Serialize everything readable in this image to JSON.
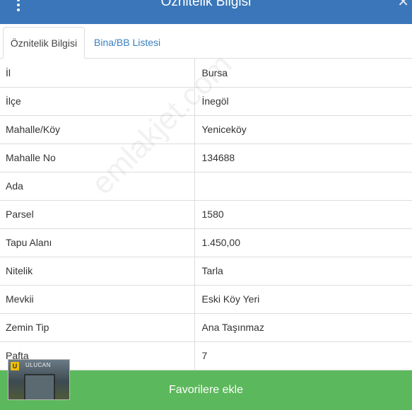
{
  "header": {
    "title": "Öznitelik Bilgisi",
    "menu_icon": "more-vertical-icon",
    "close_icon": "close-icon"
  },
  "tabs": [
    {
      "label": "Öznitelik Bilgisi",
      "active": true
    },
    {
      "label": "Bina/BB Listesi",
      "active": false
    }
  ],
  "rows": [
    {
      "key": "İl",
      "value": "Bursa"
    },
    {
      "key": "İlçe",
      "value": "İnegöl"
    },
    {
      "key": "Mahalle/Köy",
      "value": "Yeniceköy"
    },
    {
      "key": "Mahalle No",
      "value": "134688"
    },
    {
      "key": "Ada",
      "value": ""
    },
    {
      "key": "Parsel",
      "value": "1580"
    },
    {
      "key": "Tapu Alanı",
      "value": "1.450,00"
    },
    {
      "key": "Nitelik",
      "value": "Tarla"
    },
    {
      "key": "Mevkii",
      "value": "Eski Köy Yeri"
    },
    {
      "key": "Zemin Tip",
      "value": "Ana Taşınmaz"
    },
    {
      "key": "Pafta",
      "value": "7"
    }
  ],
  "watermark": "emlakjet.com",
  "logo": {
    "text": "ULUCAN",
    "badge": "U"
  },
  "footer": {
    "button_label": "Favorilere ekle"
  },
  "colors": {
    "header": "#3a76b9",
    "footer": "#5cb85c",
    "link": "#3a7fc1"
  }
}
